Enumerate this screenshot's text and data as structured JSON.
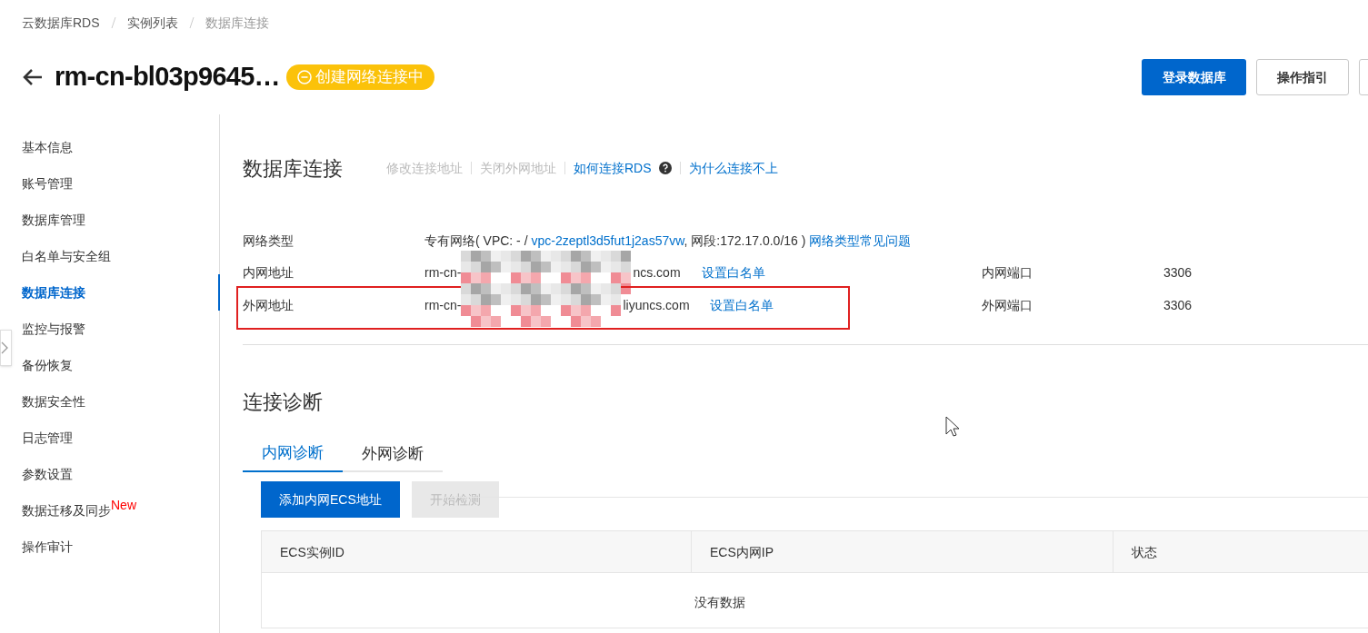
{
  "breadcrumb": [
    {
      "label": "云数据库RDS",
      "current": false
    },
    {
      "label": "实例列表",
      "current": false
    },
    {
      "label": "数据库连接",
      "current": true
    }
  ],
  "header": {
    "title": "rm-cn-bl03p9645…",
    "status": "创建网络连接中",
    "buttons": [
      {
        "label": "登录数据库",
        "primary": true
      },
      {
        "label": "操作指引",
        "primary": false
      }
    ]
  },
  "sidebar": {
    "items": [
      {
        "label": "基本信息",
        "selected": false
      },
      {
        "label": "账号管理",
        "selected": false
      },
      {
        "label": "数据库管理",
        "selected": false
      },
      {
        "label": "白名单与安全组",
        "selected": false
      },
      {
        "label": "数据库连接",
        "selected": true
      },
      {
        "label": "监控与报警",
        "selected": false
      },
      {
        "label": "备份恢复",
        "selected": false
      },
      {
        "label": "数据安全性",
        "selected": false
      },
      {
        "label": "日志管理",
        "selected": false
      },
      {
        "label": "参数设置",
        "selected": false
      },
      {
        "label": "数据迁移及同步",
        "selected": false,
        "badge": "New"
      },
      {
        "label": "操作审计",
        "selected": false
      }
    ]
  },
  "connection": {
    "title": "数据库连接",
    "actions": [
      {
        "label": "修改连接地址",
        "disabled": true
      },
      {
        "label": "关闭外网地址",
        "disabled": true
      },
      {
        "label": "如何连接RDS",
        "disabled": false,
        "help": true
      },
      {
        "label": "为什么连接不上",
        "disabled": false
      }
    ],
    "network_type": {
      "label": "网络类型",
      "prefix": "专有网络( VPC: - / ",
      "vpc": "vpc-2zeptl3d5fut1j2as57vw",
      "suffix": ", 网段:172.17.0.0/16 )",
      "link": "网络类型常见问题"
    },
    "addresses": [
      {
        "label": "内网地址",
        "address_start": "rm-cn-",
        "address_end": "ncs.com",
        "whitelist": "设置白名单",
        "port_label": "内网端口",
        "port": "3306",
        "highlighted": false
      },
      {
        "label": "外网地址",
        "address_start": "rm-cn-",
        "address_end": "liyuncs.com",
        "whitelist": "设置白名单",
        "port_label": "外网端口",
        "port": "3306",
        "highlighted": true
      }
    ]
  },
  "diagnosis": {
    "title": "连接诊断",
    "tabs": [
      {
        "label": "内网诊断",
        "selected": true
      },
      {
        "label": "外网诊断",
        "selected": false
      }
    ],
    "buttons": [
      {
        "label": "添加内网ECS地址",
        "disabled": false
      },
      {
        "label": "开始检测",
        "disabled": true
      }
    ],
    "table": {
      "columns": [
        "ECS实例ID",
        "ECS内网IP",
        "状态"
      ],
      "empty": "没有数据"
    }
  }
}
